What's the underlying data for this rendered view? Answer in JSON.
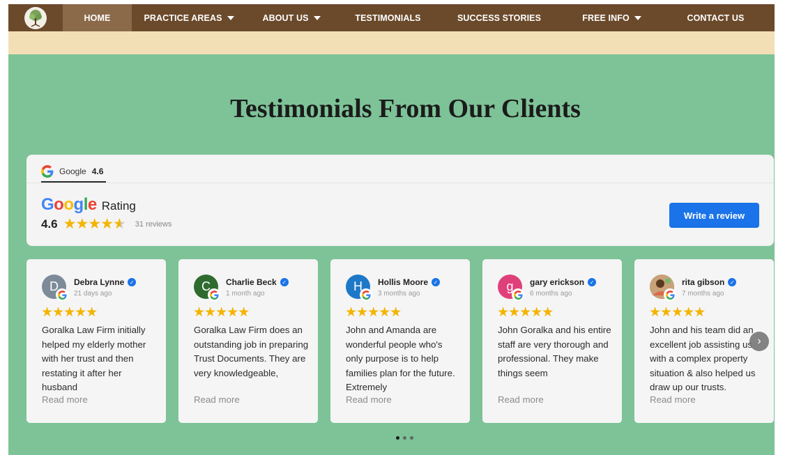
{
  "nav": {
    "items": [
      {
        "label": "HOME",
        "has_dropdown": false,
        "active": true
      },
      {
        "label": "PRACTICE AREAS",
        "has_dropdown": true
      },
      {
        "label": "ABOUT US",
        "has_dropdown": true
      },
      {
        "label": "TESTIMONIALS",
        "has_dropdown": false
      },
      {
        "label": "SUCCESS STORIES",
        "has_dropdown": false
      },
      {
        "label": "FREE INFO",
        "has_dropdown": true
      },
      {
        "label": "CONTACT US",
        "has_dropdown": false
      }
    ]
  },
  "section": {
    "title": "Testimonials From Our Clients"
  },
  "rating_panel": {
    "tab_source": "Google",
    "tab_score": "4.6",
    "brand_word": "Google",
    "rating_label": "Rating",
    "score": "4.6",
    "stars": 4.6,
    "review_count": "31 reviews",
    "write_review_label": "Write a review"
  },
  "reviews": [
    {
      "name": "Debra Lynne",
      "initial": "D",
      "avatar_color": "#7d8b99",
      "time": "21 days ago",
      "stars": 5,
      "text": "Goralka Law Firm initially helped my elderly mother with her trust and then restating it after her husband",
      "read_more": "Read more"
    },
    {
      "name": "Charlie Beck",
      "initial": "C",
      "avatar_color": "#2f6b2f",
      "time": "1 month ago",
      "stars": 5,
      "text": "Goralka Law Firm does an outstanding job in preparing Trust Documents. They are very knowledgeable,",
      "read_more": "Read more"
    },
    {
      "name": "Hollis Moore",
      "initial": "H",
      "avatar_color": "#1e78c8",
      "time": "3 months ago",
      "stars": 5,
      "text": "John and Amanda are wonderful people who's only purpose is to help families plan for the future. Extremely",
      "read_more": "Read more"
    },
    {
      "name": "gary erickson",
      "initial": "g",
      "avatar_color": "#e0407a",
      "time": "6 months ago",
      "stars": 5,
      "text": "John Goralka and his entire staff are very thorough and professional. They make things seem",
      "read_more": "Read more"
    },
    {
      "name": "rita gibson",
      "initial": "",
      "avatar_color": "#b48a5a",
      "time": "7 months ago",
      "stars": 5,
      "text": "John and his team did an excellent job assisting us with a complex property situation & also helped us draw up our trusts.",
      "read_more": "Read more"
    }
  ],
  "carousel": {
    "dots": 3,
    "active_dot": 0
  },
  "colors": {
    "nav_bg": "#6b4a2b",
    "nav_active_bg": "#8b6a4a",
    "beige_band": "#f3dfb6",
    "section_bg": "#7dc397",
    "button_blue": "#1a73e8",
    "star_gold": "#f4b400"
  },
  "icons": [
    "tree-logo-icon",
    "caret-down-icon",
    "google-g-icon",
    "star-icon",
    "verified-check-icon",
    "chevron-right-icon",
    "quote-icon"
  ]
}
